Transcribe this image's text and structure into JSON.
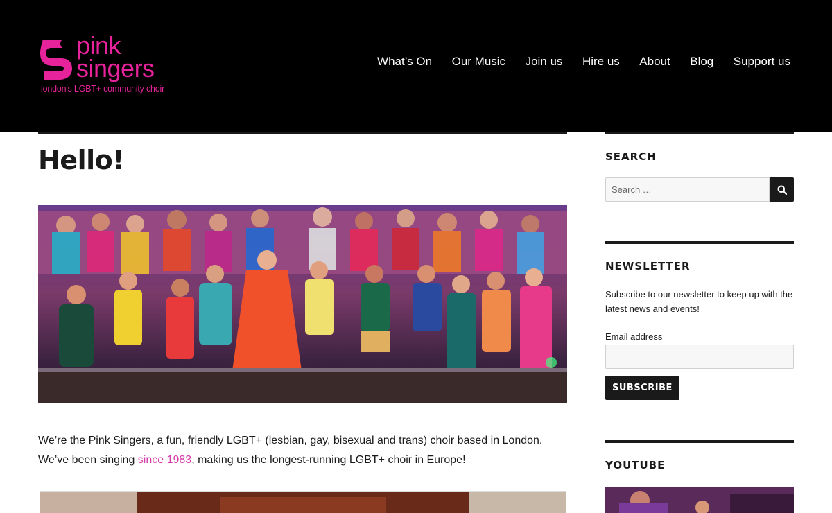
{
  "header": {
    "logo": {
      "word1": "pink",
      "word2": "singers",
      "tagline": "london's LGBT+ community choir"
    },
    "nav": [
      {
        "label": "What’s On"
      },
      {
        "label": "Our Music"
      },
      {
        "label": "Join us"
      },
      {
        "label": "Hire us"
      },
      {
        "label": "About"
      },
      {
        "label": "Blog"
      },
      {
        "label": "Support us"
      }
    ]
  },
  "main": {
    "title": "Hello!",
    "hero_image": "choir-performance-photo",
    "intro_before": "We’re the Pink Singers, a fun, friendly LGBT+ (lesbian, gay, bisexual and trans) choir based in London. We’ve been singing ",
    "intro_link": "since 1983",
    "intro_after": ", making us the longest-running LGBT+ choir in Europe!"
  },
  "sidebar": {
    "search": {
      "title": "SEARCH",
      "placeholder": "Search …"
    },
    "newsletter": {
      "title": "NEWSLETTER",
      "text": "Subscribe to our newsletter to keep up with the latest news and events!",
      "email_label": "Email address",
      "button": "SUBSCRIBE"
    },
    "youtube": {
      "title": "YOUTUBE"
    }
  },
  "colors": {
    "brand_pink": "#e6239a",
    "link_pink": "#d63aa8",
    "header_bg": "#000000",
    "text": "#1a1a1a"
  },
  "icons": {
    "search": "search-icon",
    "logo": "pink-singers-logo-icon"
  }
}
